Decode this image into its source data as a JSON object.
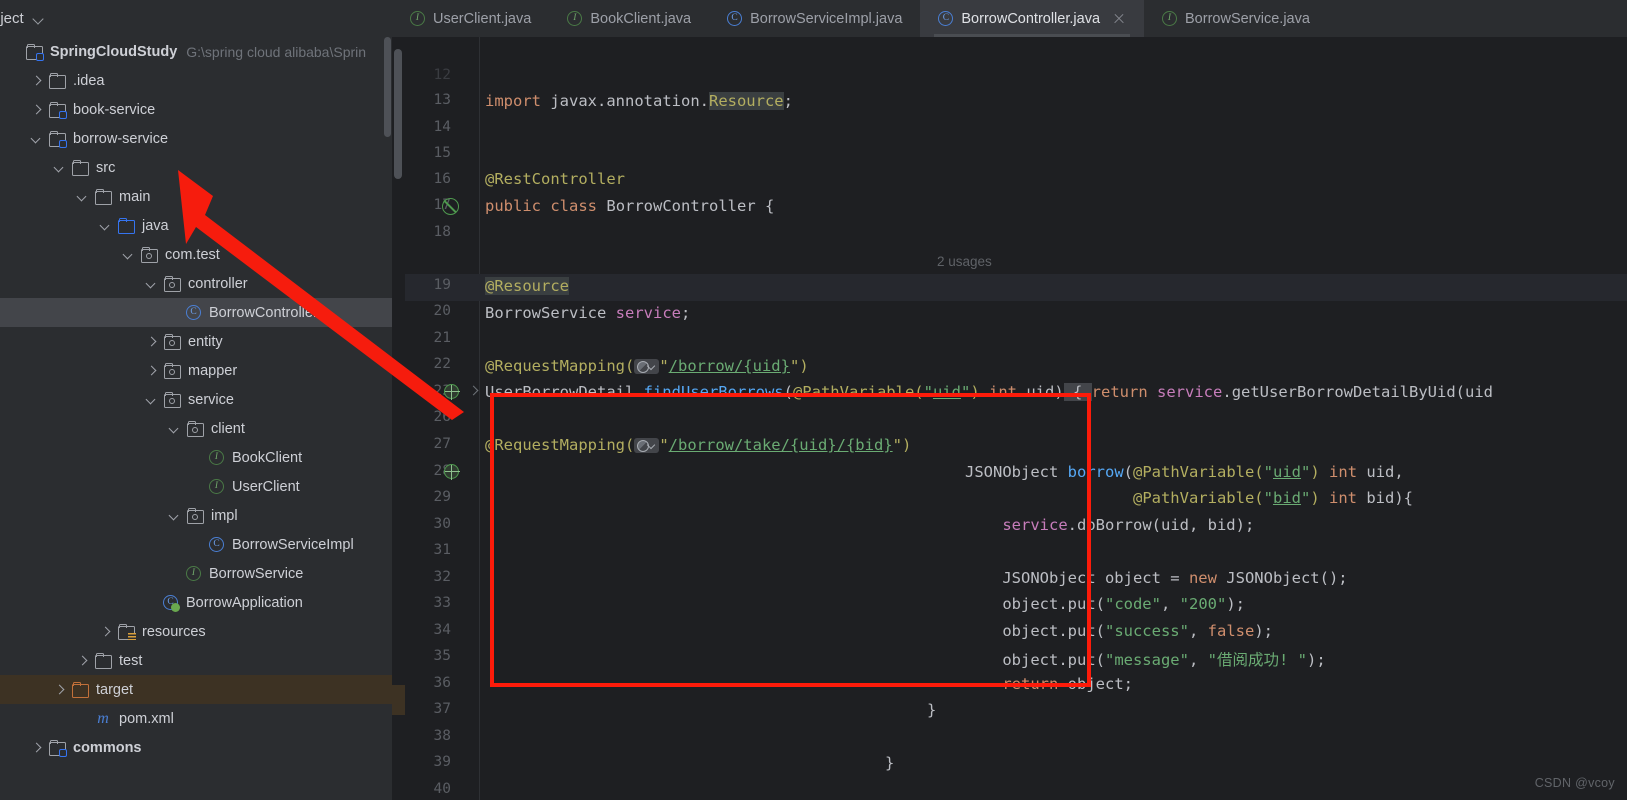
{
  "project_tool": {
    "title": "oject",
    "chevron_icon": "chevron-down-icon"
  },
  "tabs": [
    {
      "label": "UserClient.java",
      "kind": "interface",
      "active": false,
      "closable": false
    },
    {
      "label": "BookClient.java",
      "kind": "interface",
      "active": false,
      "closable": false
    },
    {
      "label": "BorrowServiceImpl.java",
      "kind": "class",
      "active": false,
      "closable": false
    },
    {
      "label": "BorrowController.java",
      "kind": "class",
      "active": true,
      "closable": true
    },
    {
      "label": "BorrowService.java",
      "kind": "interface",
      "active": false,
      "closable": false
    }
  ],
  "tree": [
    {
      "label": "SpringCloudStudy",
      "path": "G:\\spring cloud alibaba\\Sprin",
      "indent": 0,
      "icon": "module-folder-icon",
      "arrow": "none",
      "bold": true
    },
    {
      "label": ".idea",
      "indent": 1,
      "icon": "folder-icon",
      "arrow": "right"
    },
    {
      "label": "book-service",
      "indent": 1,
      "icon": "module-folder-icon",
      "arrow": "right"
    },
    {
      "label": "borrow-service",
      "indent": 1,
      "icon": "module-folder-icon",
      "arrow": "down"
    },
    {
      "label": "src",
      "indent": 2,
      "icon": "folder-icon",
      "arrow": "down"
    },
    {
      "label": "main",
      "indent": 3,
      "icon": "folder-icon",
      "arrow": "down"
    },
    {
      "label": "java",
      "indent": 4,
      "icon": "source-folder-icon",
      "arrow": "down"
    },
    {
      "label": "com.test",
      "indent": 5,
      "icon": "package-icon",
      "arrow": "down"
    },
    {
      "label": "controller",
      "indent": 6,
      "icon": "package-icon",
      "arrow": "down"
    },
    {
      "label": "BorrowController",
      "indent": 7,
      "icon": "class-icon",
      "arrow": "none",
      "selected": true
    },
    {
      "label": "entity",
      "indent": 6,
      "icon": "package-icon",
      "arrow": "right"
    },
    {
      "label": "mapper",
      "indent": 6,
      "icon": "package-icon",
      "arrow": "right"
    },
    {
      "label": "service",
      "indent": 6,
      "icon": "package-icon",
      "arrow": "down"
    },
    {
      "label": "client",
      "indent": 7,
      "icon": "package-icon",
      "arrow": "down"
    },
    {
      "label": "BookClient",
      "indent": 8,
      "icon": "interface-icon",
      "arrow": "none"
    },
    {
      "label": "UserClient",
      "indent": 8,
      "icon": "interface-icon",
      "arrow": "none"
    },
    {
      "label": "impl",
      "indent": 7,
      "icon": "package-icon",
      "arrow": "down"
    },
    {
      "label": "BorrowServiceImpl",
      "indent": 8,
      "icon": "class-icon",
      "arrow": "none"
    },
    {
      "label": "BorrowService",
      "indent": 7,
      "icon": "interface-icon",
      "arrow": "none"
    },
    {
      "label": "BorrowApplication",
      "indent": 6,
      "icon": "spring-class-icon",
      "arrow": "none"
    },
    {
      "label": "resources",
      "indent": 4,
      "icon": "resources-folder-icon",
      "arrow": "right"
    },
    {
      "label": "test",
      "indent": 3,
      "icon": "folder-icon",
      "arrow": "right"
    },
    {
      "label": "target",
      "indent": 2,
      "icon": "excluded-folder-icon",
      "arrow": "right",
      "excluded": true
    },
    {
      "label": "pom.xml",
      "indent": 3,
      "icon": "maven-icon",
      "arrow": "none"
    },
    {
      "label": "commons",
      "indent": 1,
      "icon": "module-folder-icon",
      "arrow": "right",
      "bold": true
    }
  ],
  "editor": {
    "file": "BorrowController.java",
    "first_visible_line": 12,
    "last_visible_line": 40,
    "inlay_hints": [
      {
        "line": 19,
        "text": "2 usages"
      }
    ],
    "lines": [
      {
        "n": 13,
        "text": "import javax.annotation.Resource;"
      },
      {
        "n": 14,
        "text": ""
      },
      {
        "n": 15,
        "text": ""
      },
      {
        "n": 16,
        "text": "@RestController"
      },
      {
        "n": 17,
        "text": "public class BorrowController {",
        "gutter": "suppress-inspection-icon"
      },
      {
        "n": 18,
        "text": ""
      },
      {
        "n": 19,
        "text": "    @Resource",
        "highlighted": true
      },
      {
        "n": 20,
        "text": "    BorrowService service;"
      },
      {
        "n": 21,
        "text": ""
      },
      {
        "n": 22,
        "text": "    @RequestMapping(\"/borrow/{uid}\")"
      },
      {
        "n": 23,
        "text": "    UserBorrowDetail findUserBorrows(@PathVariable(\"uid\") int uid) { return service.getUserBorrowDetailByUid(uid",
        "gutter": "web-mapping-icon",
        "folded": true
      },
      {
        "n": 26,
        "text": ""
      },
      {
        "n": 27,
        "text": "    @RequestMapping(\"/borrow/take/{uid}/{bid}\")"
      },
      {
        "n": 28,
        "text": "    JSONObject borrow(@PathVariable(\"uid\") int uid,",
        "gutter": "web-mapping-icon"
      },
      {
        "n": 29,
        "text": "                      @PathVariable(\"bid\") int bid){"
      },
      {
        "n": 30,
        "text": "        service.doBorrow(uid, bid);"
      },
      {
        "n": 31,
        "text": ""
      },
      {
        "n": 32,
        "text": "        JSONObject object = new JSONObject();"
      },
      {
        "n": 33,
        "text": "        object.put(\"code\", \"200\");"
      },
      {
        "n": 34,
        "text": "        object.put(\"success\", false);"
      },
      {
        "n": 35,
        "text": "        object.put(\"message\", \"借阅成功! \");"
      },
      {
        "n": 36,
        "text": "        return object;"
      },
      {
        "n": 37,
        "text": "    }"
      },
      {
        "n": 38,
        "text": ""
      },
      {
        "n": 39,
        "text": "}"
      },
      {
        "n": 40,
        "text": ""
      }
    ]
  },
  "annotations": {
    "red_box_label": "highlighted-code-region",
    "red_arrow_label": "pointer-to-borrow-controller"
  },
  "watermark": "CSDN @vcoy",
  "colors": {
    "sidebar_bg": "#2b2d30",
    "editor_bg": "#1e1f22",
    "selection_bg": "#43454a",
    "excluded_bg": "#3d3223",
    "annotation_red": "#fc1b0a",
    "keyword": "#cf8e6d",
    "annotation_yellow": "#b3ae60",
    "string_green": "#6aab73",
    "method_blue": "#56a8f5",
    "field_purple": "#c77dbb"
  }
}
